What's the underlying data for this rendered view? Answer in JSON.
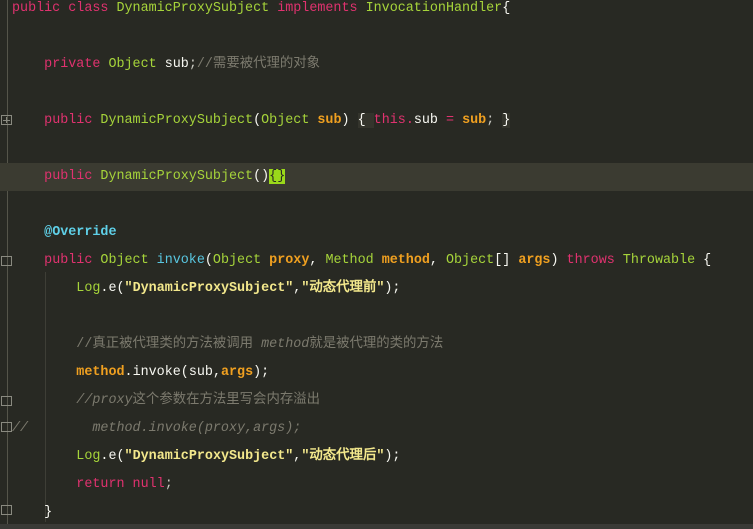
{
  "editor": {
    "colors": {
      "background": "#282923",
      "keyword": "#e0326f",
      "type": "#a6d43a",
      "function": "#59c6e0",
      "param": "#f0a020",
      "string": "#f3e88c",
      "comment": "#7c7a6e",
      "current_line": "#3b3b31",
      "bracket_match": "#9ad81a"
    },
    "lines": [
      {
        "row": 0,
        "tokens": [
          [
            "public ",
            "kw"
          ],
          [
            "class ",
            "kw"
          ],
          [
            "DynamicProxySubject ",
            "ty"
          ],
          [
            "implements ",
            "kw"
          ],
          [
            "InvocationHandler",
            "ty"
          ],
          [
            "{",
            "pl"
          ]
        ]
      },
      {
        "row": 2,
        "tokens": [
          [
            "    ",
            "pl"
          ],
          [
            "private ",
            "kw"
          ],
          [
            "Object ",
            "ty"
          ],
          [
            "sub",
            "pl"
          ],
          [
            ";",
            "pu"
          ],
          [
            "//需要被代理的对象",
            "cm"
          ]
        ]
      },
      {
        "row": 4,
        "tokens": [
          [
            "    ",
            "pl"
          ],
          [
            "public ",
            "kw"
          ],
          [
            "DynamicProxySubject",
            "ty"
          ],
          [
            "(",
            "pl"
          ],
          [
            "Object ",
            "ty"
          ],
          [
            "sub",
            "pa"
          ],
          [
            ") ",
            "pl"
          ],
          [
            "{ ",
            "pl box"
          ],
          [
            "this",
            "kw"
          ],
          [
            ".",
            "kw"
          ],
          [
            "sub ",
            "pl"
          ],
          [
            "= ",
            "kw"
          ],
          [
            "sub",
            "pa"
          ],
          [
            "; ",
            "pu"
          ],
          [
            "}",
            "pl box"
          ]
        ]
      },
      {
        "row": 6,
        "current": true,
        "tokens": [
          [
            "    ",
            "pl"
          ],
          [
            "public ",
            "kw"
          ],
          [
            "DynamicProxySubject",
            "ty"
          ],
          [
            "()",
            "pl"
          ],
          [
            "{}",
            "match"
          ]
        ]
      },
      {
        "row": 8,
        "tokens": [
          [
            "    ",
            "pl"
          ],
          [
            "@Override",
            "an"
          ]
        ]
      },
      {
        "row": 9,
        "tokens": [
          [
            "    ",
            "pl"
          ],
          [
            "public ",
            "kw"
          ],
          [
            "Object ",
            "ty"
          ],
          [
            "invoke",
            "fn"
          ],
          [
            "(",
            "pl"
          ],
          [
            "Object ",
            "ty"
          ],
          [
            "proxy",
            "pa"
          ],
          [
            ", ",
            "pl"
          ],
          [
            "Method ",
            "ty"
          ],
          [
            "method",
            "pa"
          ],
          [
            ", ",
            "pl"
          ],
          [
            "Object",
            "ty"
          ],
          [
            "[] ",
            "pl"
          ],
          [
            "args",
            "pa"
          ],
          [
            ") ",
            "pl"
          ],
          [
            "throws ",
            "kw"
          ],
          [
            "Throwable ",
            "ty"
          ],
          [
            "{",
            "pl"
          ]
        ]
      },
      {
        "row": 10,
        "tokens": [
          [
            "        ",
            "pl"
          ],
          [
            "Log",
            "ty"
          ],
          [
            ".",
            "pl"
          ],
          [
            "e",
            "pl"
          ],
          [
            "(",
            "pl"
          ],
          [
            "\"DynamicProxySubject\"",
            "st"
          ],
          [
            ",",
            "pl"
          ],
          [
            "\"动态代理前\"",
            "st"
          ],
          [
            ");",
            "pl"
          ]
        ]
      },
      {
        "row": 12,
        "tokens": [
          [
            "        ",
            "pl"
          ],
          [
            "//真正被代理类的方法被调用 ",
            "cm"
          ],
          [
            "method",
            "cmi"
          ],
          [
            "就是被代理的类的方法",
            "cm"
          ]
        ]
      },
      {
        "row": 13,
        "tokens": [
          [
            "        ",
            "pl"
          ],
          [
            "method",
            "pa"
          ],
          [
            ".",
            "pl"
          ],
          [
            "invoke",
            "pl"
          ],
          [
            "(",
            "pl"
          ],
          [
            "sub",
            "pl"
          ],
          [
            ",",
            "pl"
          ],
          [
            "args",
            "pa"
          ],
          [
            ");",
            "pl"
          ]
        ]
      },
      {
        "row": 14,
        "tokens": [
          [
            "        ",
            "pl"
          ],
          [
            "//proxy",
            "cmi"
          ],
          [
            "这个参数在方法里写会内存溢出",
            "cm"
          ]
        ]
      },
      {
        "row": 15,
        "tokens": [
          [
            "//        ",
            "cmi"
          ],
          [
            "method.invoke(proxy,args);",
            "cmi"
          ]
        ]
      },
      {
        "row": 16,
        "tokens": [
          [
            "        ",
            "pl"
          ],
          [
            "Log",
            "ty"
          ],
          [
            ".",
            "pl"
          ],
          [
            "e",
            "pl"
          ],
          [
            "(",
            "pl"
          ],
          [
            "\"DynamicProxySubject\"",
            "st"
          ],
          [
            ",",
            "pl"
          ],
          [
            "\"动态代理后\"",
            "st"
          ],
          [
            ");",
            "pl"
          ]
        ]
      },
      {
        "row": 17,
        "tokens": [
          [
            "        ",
            "pl"
          ],
          [
            "return ",
            "kw"
          ],
          [
            "null",
            "kw"
          ],
          [
            ";",
            "pu"
          ]
        ]
      },
      {
        "row": 18,
        "tokens": [
          [
            "    ",
            "pl"
          ],
          [
            "}",
            "pl"
          ]
        ]
      }
    ]
  }
}
